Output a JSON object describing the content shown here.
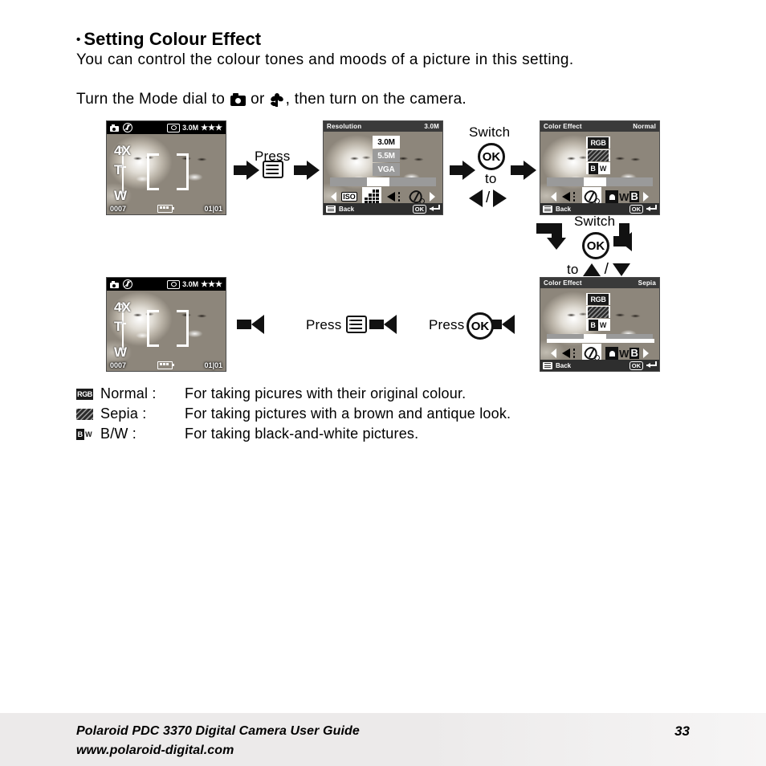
{
  "page": {
    "heading": "Setting Colour Effect",
    "heading_bullet": "•",
    "subtitle": "You can control the colour tones and moods of a picture in this setting.",
    "instruction_before": "Turn the Mode dial to",
    "instruction_or": "or",
    "instruction_after": ", then turn on the camera."
  },
  "screens": {
    "shoot": {
      "mode_icon": "camera-icon",
      "flash_icon": "flash-off-icon",
      "meter_icon": "metering-icon",
      "resolution": "3.0M",
      "quality": "★★★",
      "counter": "0007",
      "battery_icon": "battery-icon",
      "frame": "01|01",
      "zoom_top": "4X",
      "zoom_mid": "T",
      "zoom_bottom": "W"
    },
    "resolution_menu": {
      "title": "Resolution",
      "value": "3.0M",
      "options": [
        "3.0M",
        "5.5M",
        "VGA"
      ],
      "selected_option": "3.0M",
      "back_label": "Back",
      "ok_label": "OK",
      "icons": [
        "iso-icon",
        "resolution-grid-icon",
        "flash-icon",
        "colour-effect-pencil-icon"
      ],
      "selected_icon": "resolution-grid-icon"
    },
    "colour_effect_normal": {
      "title": "Color Effect",
      "value": "Normal",
      "options": [
        "RGB",
        "SEPIA",
        "BW"
      ],
      "selected_option": "RGB",
      "back_label": "Back",
      "ok_label": "OK",
      "icons": [
        "flash-icon",
        "colour-effect-pencil-icon",
        "white-balance-icon"
      ],
      "selected_icon": "colour-effect-pencil-icon"
    },
    "colour_effect_sepia": {
      "title": "Color Effect",
      "value": "Sepia",
      "options": [
        "RGB",
        "SEPIA",
        "BW"
      ],
      "selected_option": "SEPIA",
      "back_label": "Back",
      "ok_label": "OK",
      "icons": [
        "flash-icon",
        "colour-effect-pencil-icon",
        "white-balance-icon"
      ],
      "selected_icon": "colour-effect-pencil-icon"
    }
  },
  "flow": {
    "press_1": "Press",
    "switch_1_label": "Switch",
    "switch_1_to": "to",
    "switch_1_ok": "OK",
    "switch_2_label": "Switch",
    "switch_2_to": "to",
    "switch_2_ok": "OK",
    "press_ok": "Press",
    "press_ok_label": "OK",
    "press_menu": "Press"
  },
  "legend": [
    {
      "icon": "rgb-icon",
      "icon_text": "RGB",
      "name": "Normal :",
      "desc": "For taking picures with their original colour."
    },
    {
      "icon": "sepia-icon",
      "icon_text": "",
      "name": "Sepia :",
      "desc": "For taking pictures with a brown and antique look."
    },
    {
      "icon": "bw-icon",
      "icon_text": "BW",
      "name": "B/W :",
      "desc": "For taking black-and-white pictures."
    }
  ],
  "footer": {
    "line1": "Polaroid PDC 3370 Digital Camera User Guide",
    "line2": "www.polaroid-digital.com",
    "page_number": "33"
  }
}
